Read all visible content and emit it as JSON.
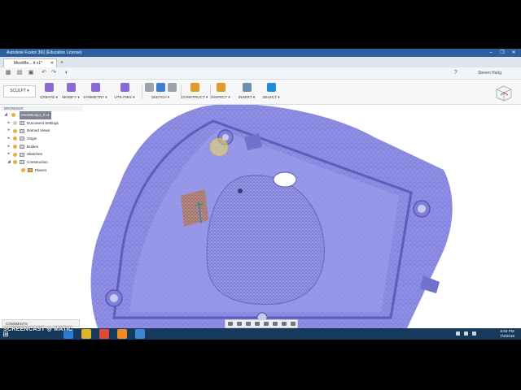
{
  "window": {
    "title": "Autodesk Fusion 360 (Education License)",
    "controls": [
      "–",
      "❐",
      "✕"
    ]
  },
  "tabs": [
    {
      "label": "MeshBo... lt v1*",
      "close": "✕"
    }
  ],
  "tab_add": "+",
  "user": {
    "name": "Steven Harig",
    "help_icon": "help-icon"
  },
  "toolbar": {
    "mode_label": "SCULPT ▾",
    "groups": [
      {
        "label": "CREATE ▾",
        "colors": [
          "#8b6ad6"
        ]
      },
      {
        "label": "MODIFY ▾",
        "colors": [
          "#8b6ad6"
        ]
      },
      {
        "label": "SYMMETRY ▾",
        "colors": [
          "#8b6ad6"
        ]
      },
      {
        "label": "UTILITIES ▾",
        "colors": [
          "#8b6ad6"
        ]
      },
      {
        "label": "SKETCH ▾",
        "colors": [
          "#9aa3ad",
          "#3f7fd1",
          "#9aa3ad"
        ]
      },
      {
        "label": "CONSTRUCT ▾",
        "colors": [
          "#e09b2d"
        ]
      },
      {
        "label": "INSPECT ▾",
        "colors": [
          "#e09b2d"
        ]
      },
      {
        "label": "INSERT ▾",
        "colors": [
          "#6c8fb8"
        ]
      },
      {
        "label": "SELECT ▾",
        "colors": [
          "#1e8fd6"
        ]
      }
    ]
  },
  "browser": {
    "header": "BROWSER",
    "root": "MeshBody1_ll v1",
    "items": [
      {
        "label": "Document Settings",
        "icon": "gear-icon"
      },
      {
        "label": "Named Views",
        "icon": "folder-icon"
      },
      {
        "label": "Origin",
        "icon": "folder-icon"
      },
      {
        "label": "Bodies",
        "icon": "folder-icon"
      },
      {
        "label": "Sketches",
        "icon": "folder-icon"
      },
      {
        "label": "Construction",
        "icon": "folder-icon"
      },
      {
        "label": "Plane1",
        "icon": "plane-icon"
      }
    ]
  },
  "comments_label": "COMMENTS",
  "watermark": "SCREENCAST ◎ MATIC",
  "taskbar": {
    "time": "8:53 PM",
    "date": "7/3/2018"
  },
  "colors": {
    "mesh": "#8f8fe6",
    "mesh_dark": "#6c6cc8",
    "section_plane": "#d7893a",
    "titlebar": "#2b5f9e",
    "taskbar": "#163a5c"
  }
}
